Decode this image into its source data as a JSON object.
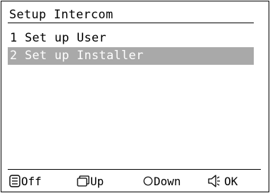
{
  "header": {
    "title": "Setup Intercom"
  },
  "menu": {
    "items": [
      {
        "label": "1 Set up User",
        "selected": false
      },
      {
        "label": "2 Set up Installer",
        "selected": true
      }
    ]
  },
  "softkeys": [
    {
      "icon": "menu-list-icon",
      "label": "Off"
    },
    {
      "icon": "square-button-icon",
      "label": "Up"
    },
    {
      "icon": "circle-button-icon",
      "label": "Down"
    },
    {
      "icon": "speaker-icon",
      "label": "OK"
    }
  ],
  "colors": {
    "selection_background": "#a9a9a9",
    "selection_text": "#ffffff",
    "foreground": "#000000",
    "background": "#ffffff"
  }
}
